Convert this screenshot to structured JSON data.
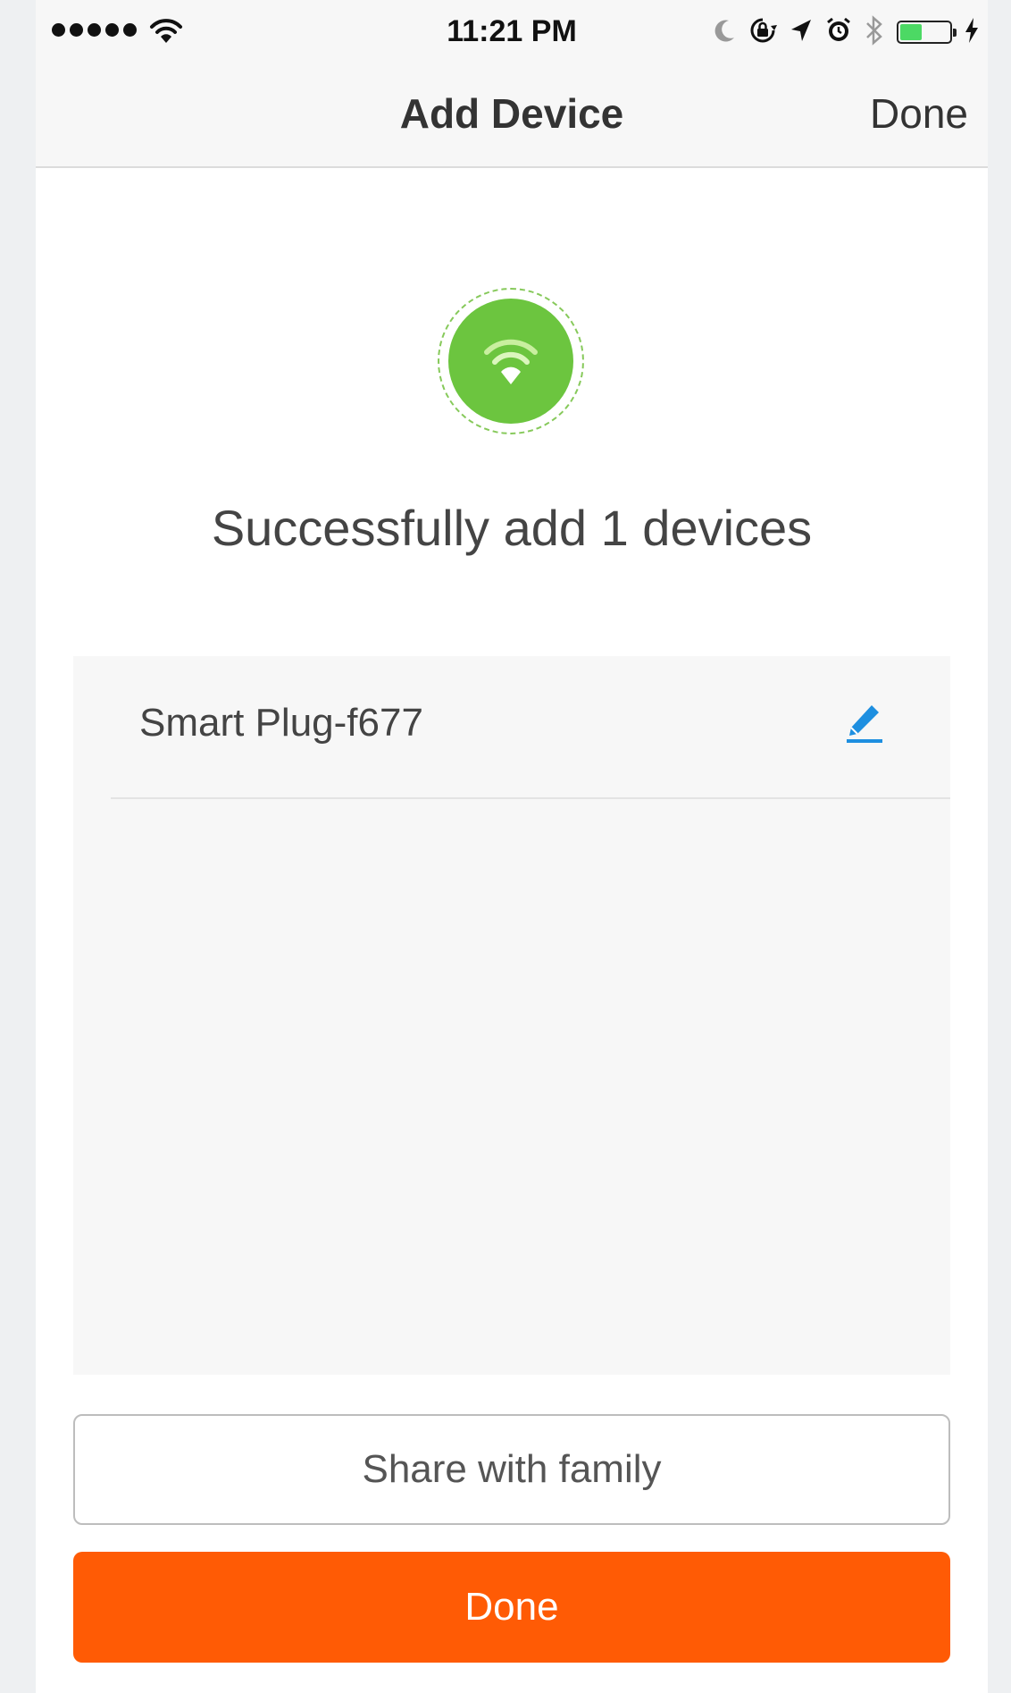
{
  "status_bar": {
    "time": "11:21 PM",
    "signal_dots": 5,
    "icons": [
      "wifi-icon",
      "moon-icon",
      "rotation-lock-icon",
      "location-arrow-icon",
      "alarm-icon",
      "bluetooth-icon",
      "battery-icon",
      "charging-bolt-icon"
    ],
    "battery_level": 0.45
  },
  "nav": {
    "title": "Add Device",
    "done_label": "Done"
  },
  "success": {
    "icon": "wifi-icon",
    "message": "Successfully add 1 devices",
    "accent_color": "#6cc53f"
  },
  "devices": [
    {
      "name": "Smart Plug-f677",
      "action_icon": "pencil-edit-icon"
    }
  ],
  "buttons": {
    "share_label": "Share with family",
    "done_label": "Done",
    "done_color": "#ff5b05"
  }
}
